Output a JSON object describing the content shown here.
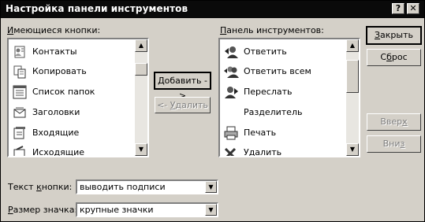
{
  "window": {
    "title": "Настройка панели инструментов",
    "help_glyph": "?",
    "close_glyph": "✕"
  },
  "available": {
    "label_pre": "",
    "label_accel": "И",
    "label_post": "меющиеся кнопки:",
    "items": [
      {
        "label": "Контакты",
        "icon": "contacts-icon"
      },
      {
        "label": "Копировать",
        "icon": "copy-icon"
      },
      {
        "label": "Список папок",
        "icon": "folder-list-icon"
      },
      {
        "label": "Заголовки",
        "icon": "headers-icon"
      },
      {
        "label": "Входящие",
        "icon": "inbox-icon"
      },
      {
        "label": "Исходящие",
        "icon": "outbox-icon"
      }
    ]
  },
  "toolbar": {
    "label_pre": "",
    "label_accel": "П",
    "label_post": "анель инструментов:",
    "items": [
      {
        "label": "Ответить",
        "icon": "reply-icon"
      },
      {
        "label": "Ответить всем",
        "icon": "reply-all-icon"
      },
      {
        "label": "Переслать",
        "icon": "forward-icon"
      },
      {
        "label": "Разделитель",
        "icon": ""
      },
      {
        "label": "Печать",
        "icon": "print-icon"
      },
      {
        "label": "Удалить",
        "icon": "delete-icon"
      }
    ]
  },
  "buttons": {
    "add_pre": "",
    "add_accel": "Д",
    "add_post": "обавить ->",
    "remove_pre": "<- ",
    "remove_accel": "У",
    "remove_post": "далить",
    "close_pre": "",
    "close_accel": "З",
    "close_post": "акрыть",
    "reset_pre": "С",
    "reset_accel": "б",
    "reset_post": "рос",
    "up_pre": "Ввер",
    "up_accel": "х",
    "up_post": "",
    "down_pre": "Вни",
    "down_accel": "з",
    "down_post": ""
  },
  "text_option": {
    "label_pre": "Текст ",
    "label_accel": "к",
    "label_post": "нопки:",
    "value": "выводить подписи"
  },
  "size_option": {
    "label_pre": "",
    "label_accel": "Р",
    "label_post": "азмер значка:",
    "value": "крупные значки"
  }
}
